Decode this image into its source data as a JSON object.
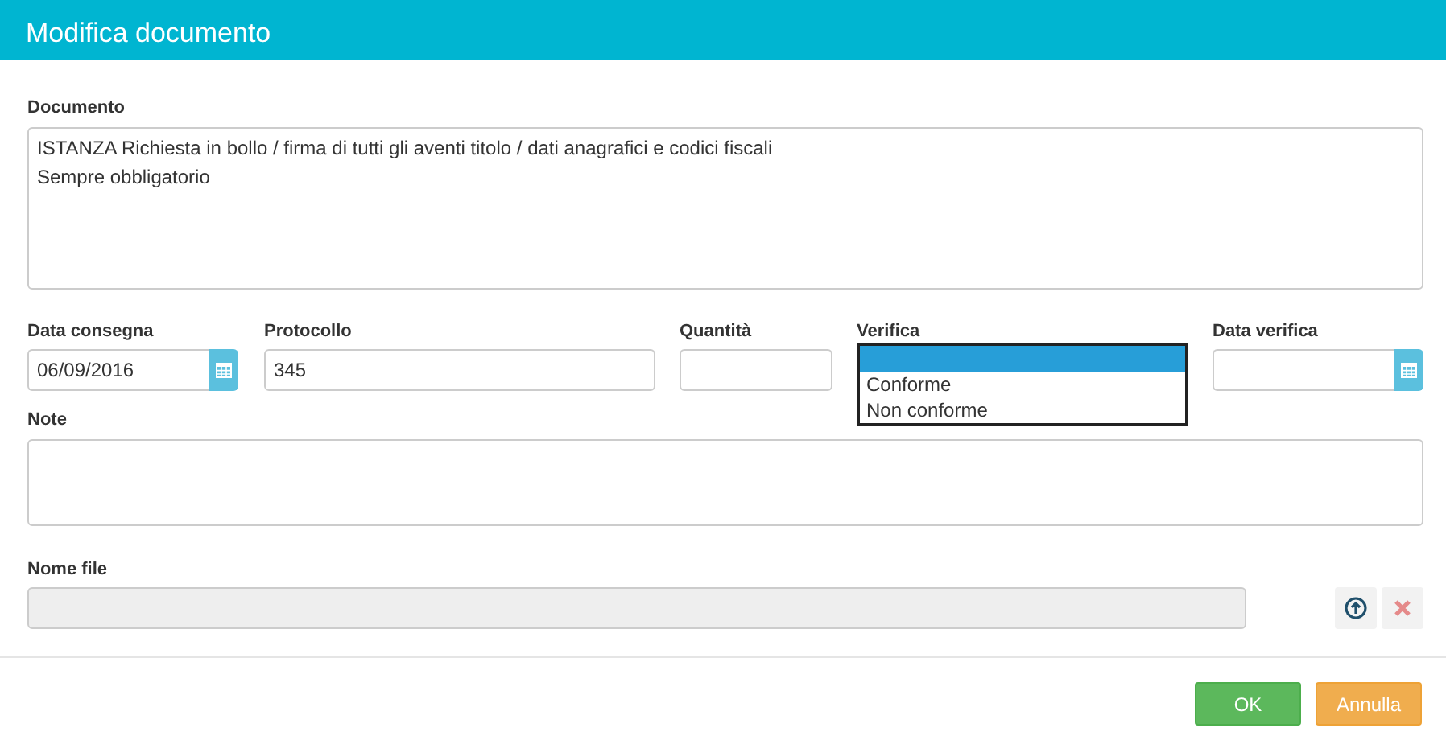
{
  "window": {
    "title": "Modifica documento"
  },
  "documento": {
    "label": "Documento",
    "value": "ISTANZA Richiesta in bollo / firma di tutti gli aventi titolo / dati anagrafici e codici fiscali\nSempre obbligatorio"
  },
  "data_consegna": {
    "label": "Data consegna",
    "value": "06/09/2016"
  },
  "protocollo": {
    "label": "Protocollo",
    "value": "345"
  },
  "quantita": {
    "label": "Quantità"
  },
  "verifica": {
    "label": "Verifica",
    "expanded": true,
    "options": [
      {
        "selected": true
      },
      {
        "label": "Conforme",
        "selected": false
      },
      {
        "label": "Non conforme",
        "selected": false
      }
    ]
  },
  "data_verifica": {
    "label": "Data verifica"
  },
  "note": {
    "label": "Note"
  },
  "nome_file": {
    "label": "Nome file"
  },
  "buttons": [
    {
      "label": "OK",
      "kind": "ok"
    },
    {
      "label": "Annulla",
      "kind": "cancel"
    }
  ]
}
